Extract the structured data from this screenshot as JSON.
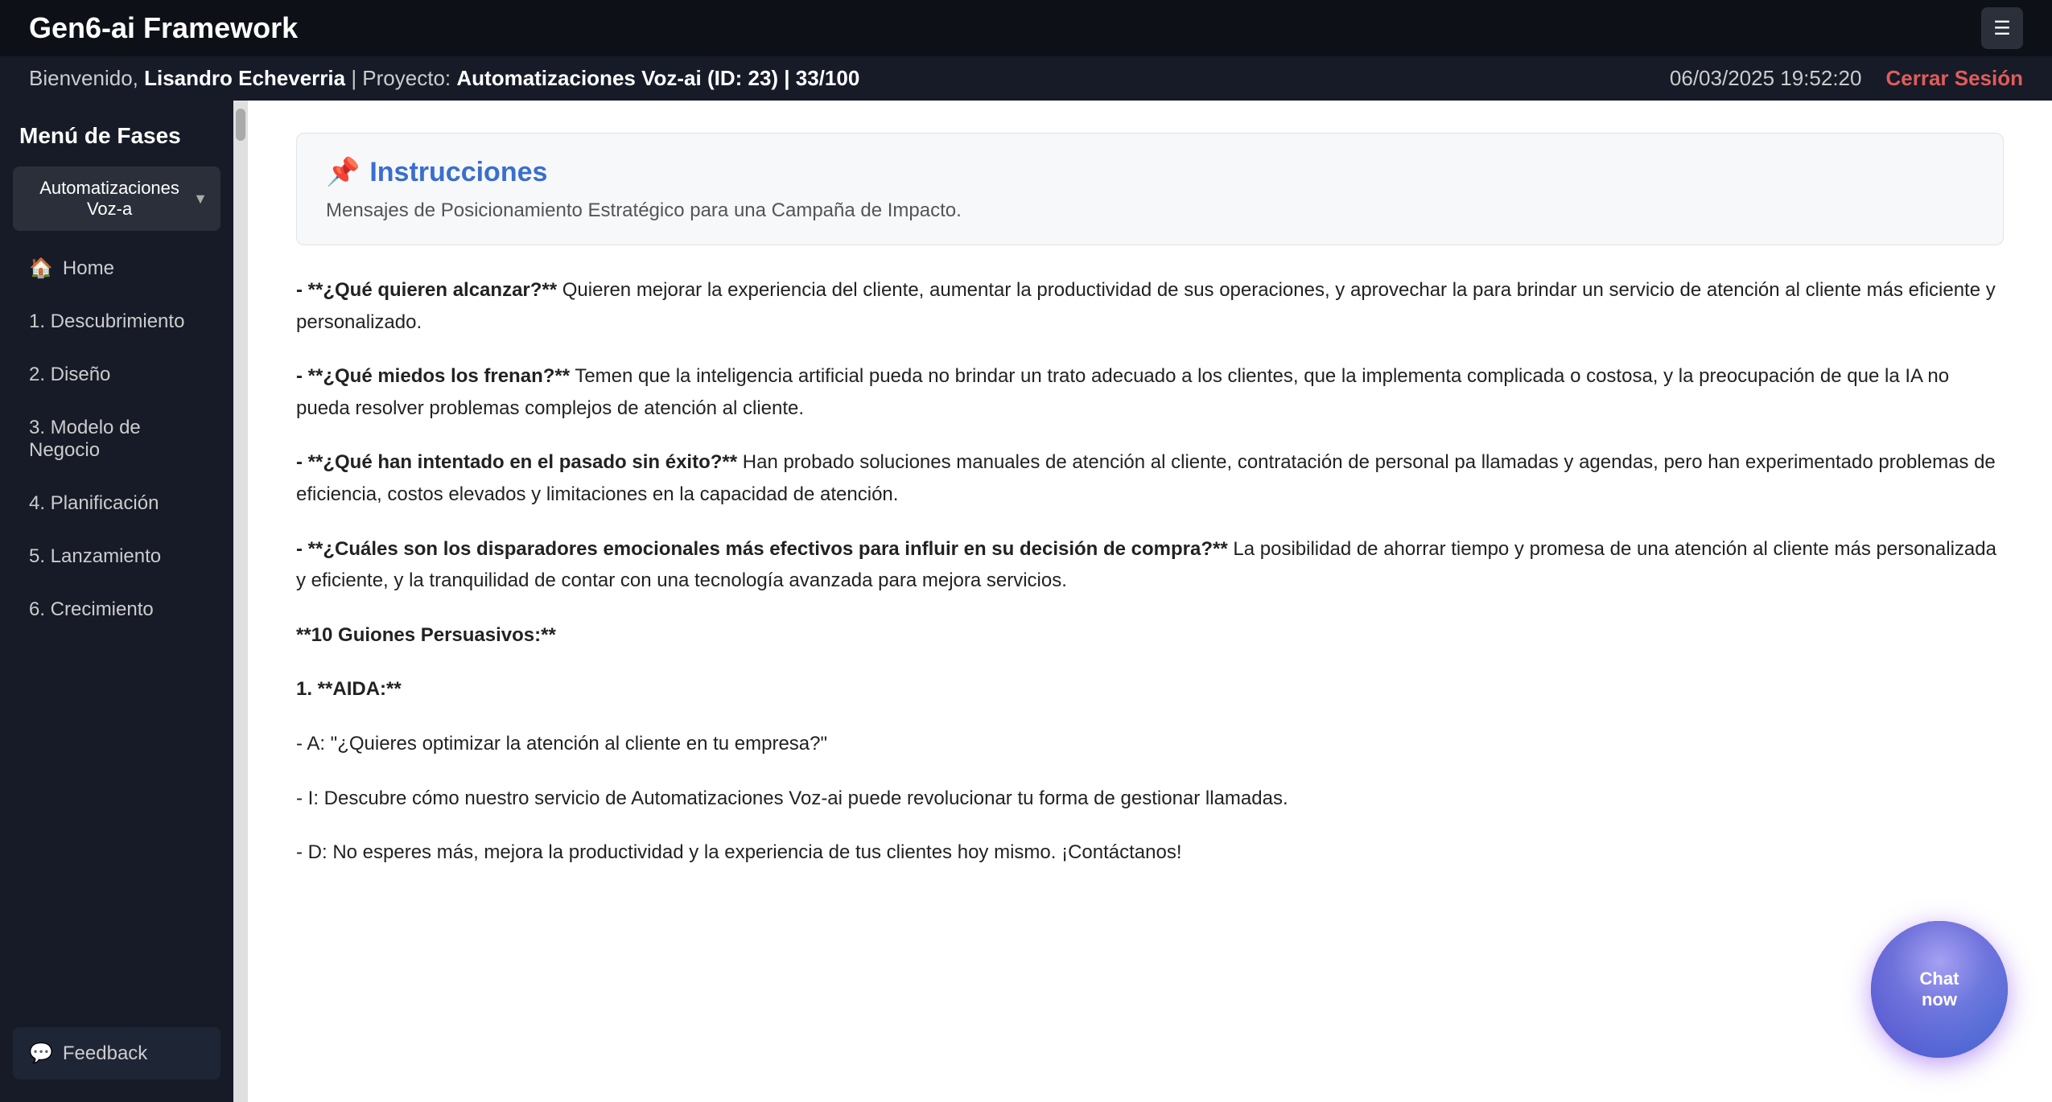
{
  "app": {
    "title": "Gen6-ai Framework"
  },
  "header": {
    "welcome_prefix": "Bienvenido, ",
    "user_name": "Lisandro Echeverria",
    "project_label": " | Proyecto: ",
    "project_name": "Automatizaciones Voz-ai (ID: 23) | 33/100",
    "datetime": "06/03/2025 19:52:20",
    "logout_label": "Cerrar Sesión"
  },
  "sidebar": {
    "title": "Menú de Fases",
    "dropdown_label": "Automatizaciones Voz-a",
    "items": [
      {
        "id": "home",
        "icon": "🏠",
        "label": "Home"
      },
      {
        "id": "descubrimiento",
        "icon": "",
        "label": "1. Descubrimiento"
      },
      {
        "id": "diseno",
        "icon": "",
        "label": "2. Diseño"
      },
      {
        "id": "modelo-negocio",
        "icon": "",
        "label": "3. Modelo de Negocio"
      },
      {
        "id": "planificacion",
        "icon": "",
        "label": "4. Planificación"
      },
      {
        "id": "lanzamiento",
        "icon": "",
        "label": "5. Lanzamiento"
      },
      {
        "id": "crecimiento",
        "icon": "",
        "label": "6. Crecimiento"
      }
    ],
    "feedback_icon": "💬",
    "feedback_label": "Feedback"
  },
  "instructions": {
    "icon": "📌",
    "title": "Instrucciones",
    "subtitle": "Mensajes de Posicionamiento Estratégico para una Campaña de Impacto."
  },
  "content": {
    "p1_bold": "- **¿Qué quieren alcanzar?**",
    "p1_text": " Quieren mejorar la experiencia del cliente, aumentar la productividad de sus operaciones, y aprovechar la para brindar un servicio de atención al cliente más eficiente y personalizado.",
    "p2_bold": "- **¿Qué miedos los frenan?**",
    "p2_text": " Temen que la inteligencia artificial pueda no brindar un trato adecuado a los clientes, que la implementa complicada o costosa, y la preocupación de que la IA no pueda resolver problemas complejos de atención al cliente.",
    "p3_bold": "- **¿Qué han intentado en el pasado sin éxito?**",
    "p3_text": " Han probado soluciones manuales de atención al cliente, contratación de personal pa llamadas y agendas, pero han experimentado problemas de eficiencia, costos elevados y limitaciones en la capacidad de atención.",
    "p4_bold": "- **¿Cuáles son los disparadores emocionales más efectivos para influir en su decisión de compra?**",
    "p4_text": " La posibilidad de ahorrar tiempo y promesa de una atención al cliente más personalizada y eficiente, y la tranquilidad de contar con una tecnología avanzada para mejora servicios.",
    "p5_header": "**10 Guiones Persuasivos:**",
    "p6_header": "1. **AIDA:**",
    "p6_a": "- A: \"¿Quieres optimizar la atención al cliente en tu empresa?\"",
    "p6_i": "- I: Descubre cómo nuestro servicio de Automatizaciones Voz-ai puede revolucionar tu forma de gestionar llamadas.",
    "p6_d": "- D: No esperes más, mejora la productividad y la experiencia de tus clientes hoy mismo. ¡Contáctanos!"
  },
  "chat": {
    "label_line1": "Chat",
    "label_line2": "now"
  },
  "hamburger_icon": "☰"
}
